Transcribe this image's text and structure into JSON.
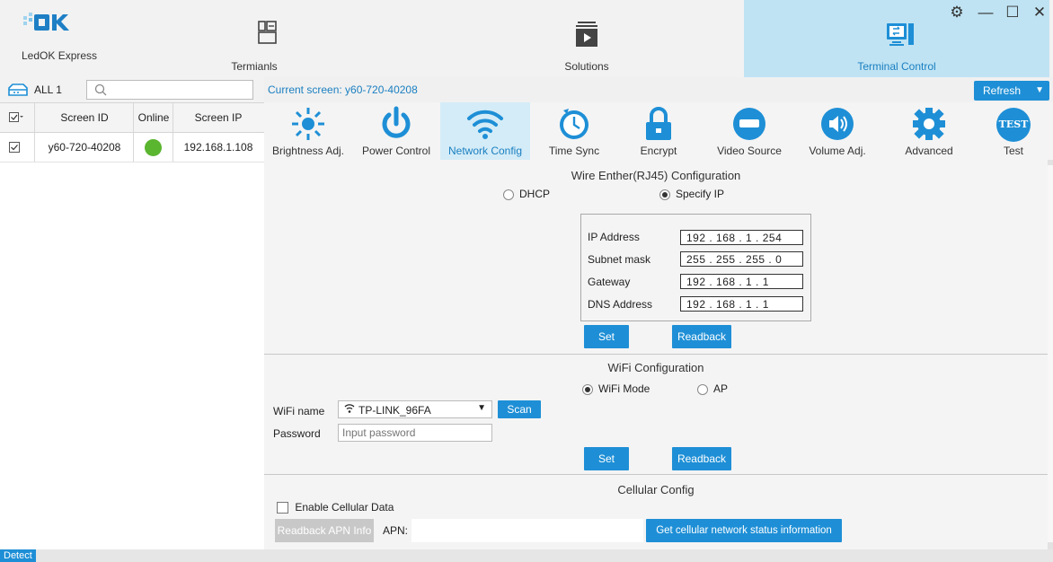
{
  "app": {
    "logo_text": "OK",
    "name": "LedOK Express"
  },
  "nav_tabs": [
    {
      "label": "Termianls",
      "icon": "terminals-icon"
    },
    {
      "label": "Solutions",
      "icon": "solutions-icon"
    },
    {
      "label": "Terminal Control",
      "icon": "terminal-control-icon"
    }
  ],
  "window_controls": {
    "settings": "⚙",
    "minimize": "—",
    "maximize": "☐",
    "close": "✕"
  },
  "left": {
    "group_label": "ALL 1",
    "columns": [
      "Screen ID",
      "Online",
      "Screen IP"
    ],
    "rows": [
      {
        "screen_id": "y60-720-40208",
        "online": true,
        "ip": "192.168.1.108"
      }
    ]
  },
  "current_screen": "Current screen: y60-720-40208",
  "refresh_label": "Refresh",
  "tools": [
    {
      "label": "Brightness Adj.",
      "icon": "brightness-icon"
    },
    {
      "label": "Power Control",
      "icon": "power-icon"
    },
    {
      "label": "Network Config",
      "icon": "wifi-icon"
    },
    {
      "label": "Time Sync",
      "icon": "clock-icon"
    },
    {
      "label": "Encrypt",
      "icon": "lock-icon"
    },
    {
      "label": "Video Source",
      "icon": "video-source-icon"
    },
    {
      "label": "Volume Adj.",
      "icon": "volume-icon"
    },
    {
      "label": "Advanced",
      "icon": "gear-icon"
    },
    {
      "label": "Test",
      "icon": "test-icon",
      "badge": "TEST"
    }
  ],
  "wire": {
    "title": "Wire Enther(RJ45) Configuration",
    "dhcp": "DHCP",
    "specify_ip": "Specify IP",
    "fields": [
      {
        "label": "IP Address",
        "value": "192 . 168 .  1  . 254"
      },
      {
        "label": "Subnet mask",
        "value": "255 . 255 . 255 .  0"
      },
      {
        "label": "Gateway",
        "value": "192 . 168 .  1  .  1"
      },
      {
        "label": "DNS Address",
        "value": "192 . 168 .  1  .  1"
      }
    ],
    "set": "Set",
    "readback": "Readback"
  },
  "wifi": {
    "title": "WiFi Configuration",
    "mode": "WiFi Mode",
    "ap": "AP",
    "name_label": "WiFi name",
    "name_value": "TP-LINK_96FA",
    "scan": "Scan",
    "password_label": "Password",
    "password_placeholder": "Input password",
    "set": "Set",
    "readback": "Readback"
  },
  "cellular": {
    "title": "Cellular Config",
    "enable": "Enable Cellular Data",
    "readback_apn": "Readback APN Info",
    "apn_label": "APN:",
    "status_btn": "Get cellular network status information"
  },
  "status": {
    "detect": "Detect"
  },
  "colors": {
    "accent": "#1e8fd6",
    "online": "#5ab52f",
    "active_tab": "#bfe3f3"
  }
}
